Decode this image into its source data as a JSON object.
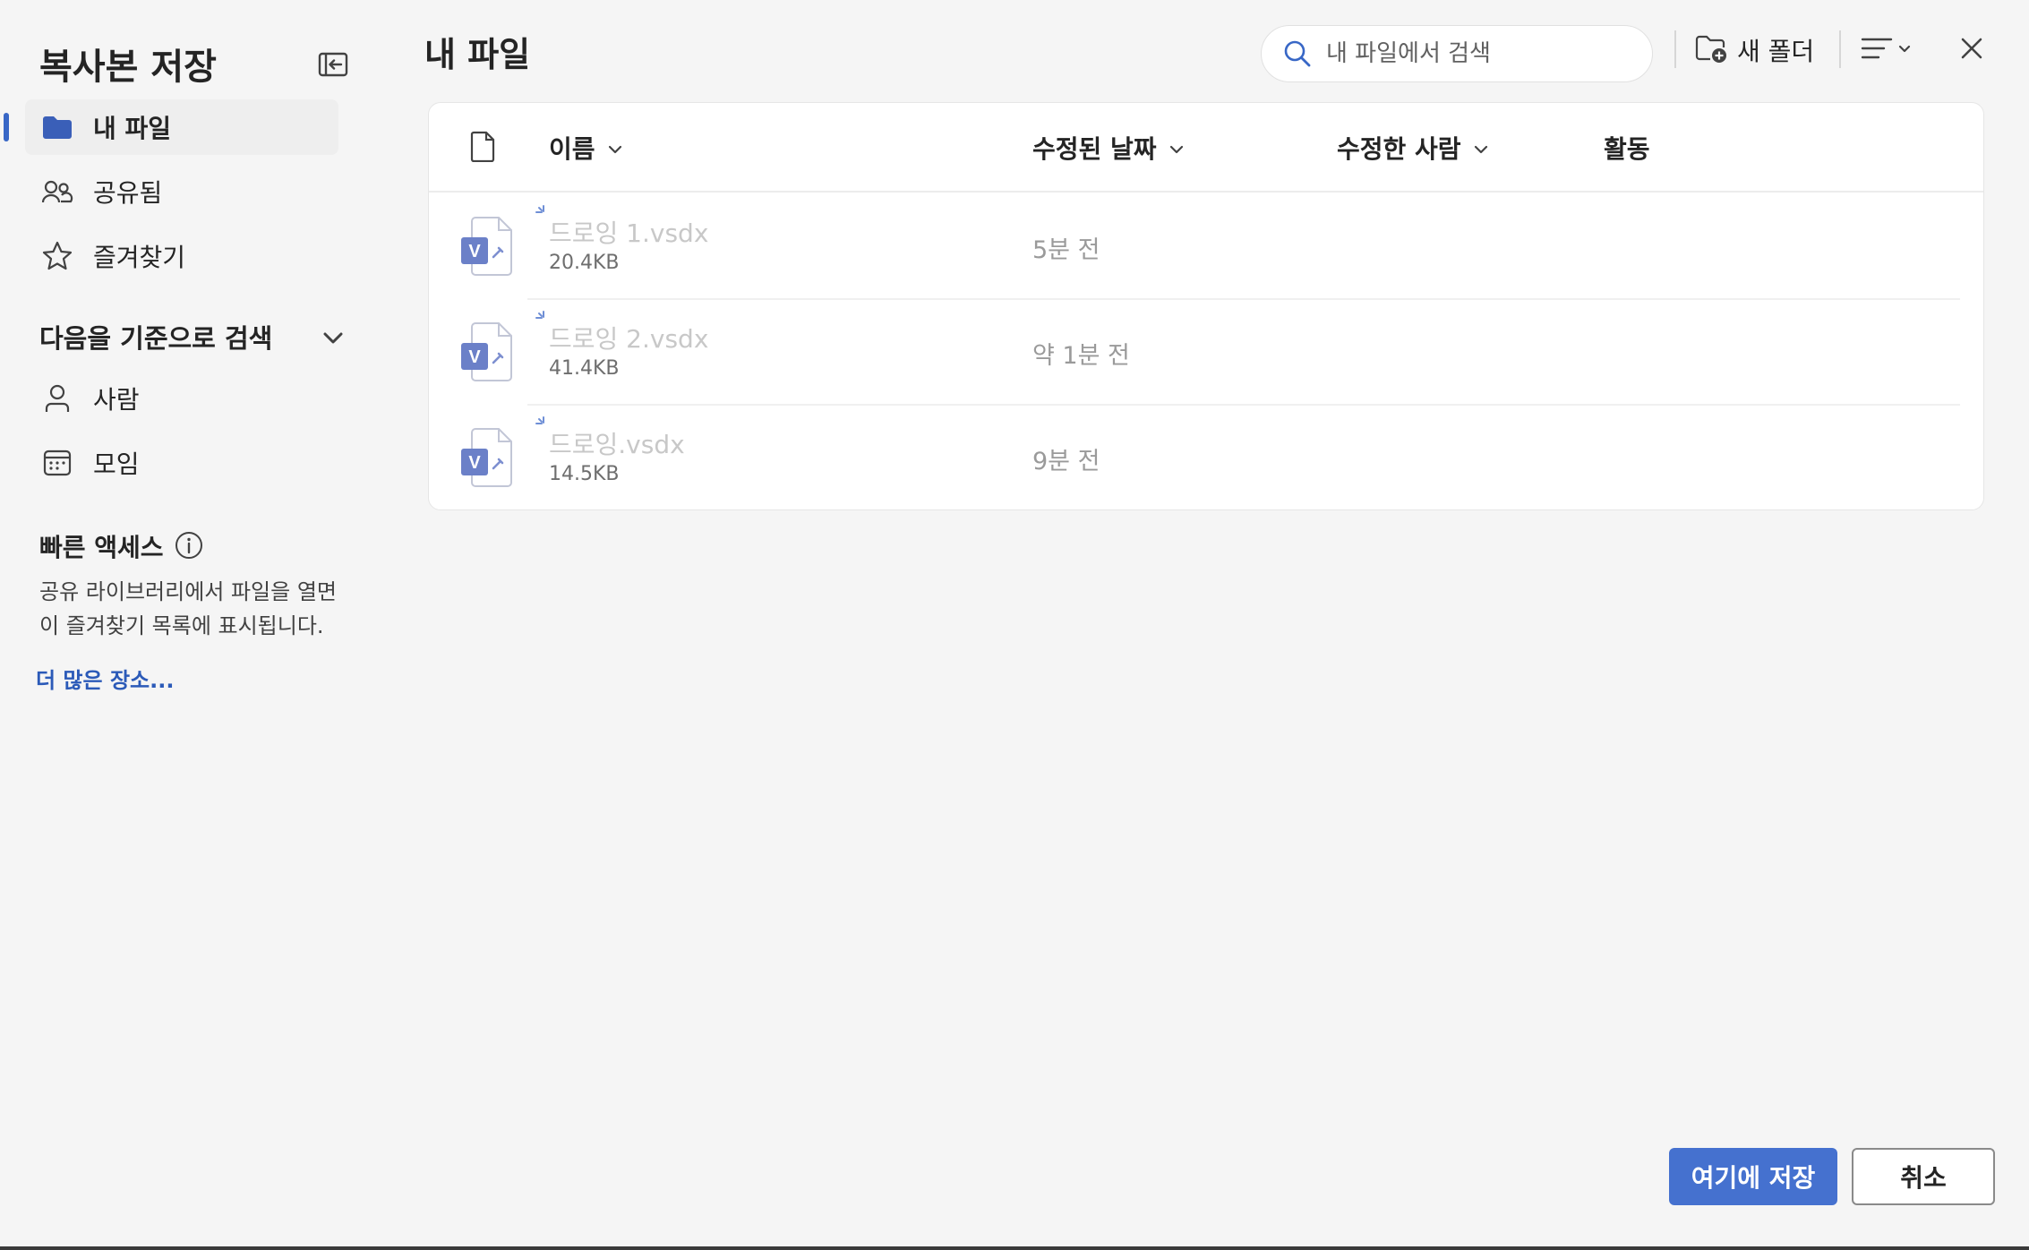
{
  "dialog": {
    "title": "복사본 저장"
  },
  "sidebar": {
    "nav": [
      {
        "label": "내 파일",
        "icon": "folder-icon",
        "active": true
      },
      {
        "label": "공유됨",
        "icon": "people-icon"
      },
      {
        "label": "즐겨찾기",
        "icon": "star-icon"
      }
    ],
    "browse_by": {
      "title": "다음을 기준으로 검색",
      "items": [
        {
          "label": "사람",
          "icon": "person-icon"
        },
        {
          "label": "모임",
          "icon": "calendar-icon"
        }
      ]
    },
    "quick_access": {
      "title": "빠른 액세스",
      "desc_line1": "공유 라이브러리에서 파일을 열면",
      "desc_line2": "이 즐겨찾기 목록에 표시됩니다.",
      "more_link": "더 많은 장소..."
    }
  },
  "main": {
    "title": "내 파일",
    "search": {
      "placeholder": "내 파일에서 검색"
    },
    "new_folder": "새 폴더",
    "table": {
      "columns": {
        "name": "이름",
        "modified": "수정된 날짜",
        "modified_by": "수정한 사람",
        "activity": "활동"
      },
      "rows": [
        {
          "name": "드로잉 1.vsdx",
          "size": "20.4KB",
          "modified": "5분 전"
        },
        {
          "name": "드로잉 2.vsdx",
          "size": "41.4KB",
          "modified": "약 1분 전"
        },
        {
          "name": "드로잉.vsdx",
          "size": "14.5KB",
          "modified": "9분 전"
        }
      ]
    }
  },
  "footer": {
    "save_label": "여기에 저장",
    "cancel_label": "취소"
  },
  "colors": {
    "accent": "#4571cf",
    "link": "#2b5ab8",
    "visio": "#6b80c8"
  }
}
